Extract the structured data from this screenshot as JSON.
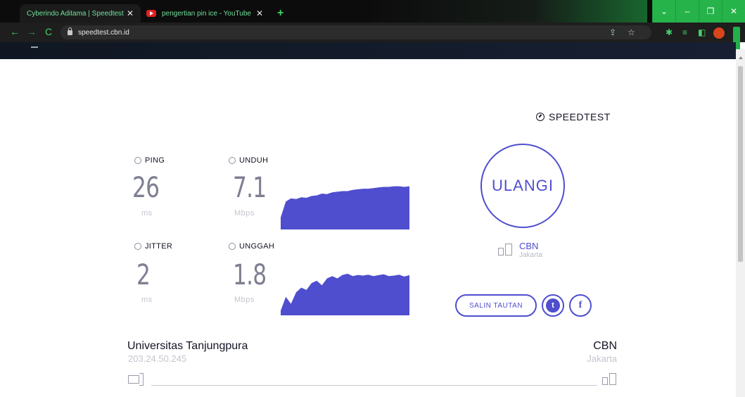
{
  "browser": {
    "tabs": [
      {
        "title": "Cyberindo Aditama | Speedtest",
        "active": true
      },
      {
        "title": "pengertian pin ice - YouTube",
        "active": false
      }
    ],
    "close_glyph": "✕",
    "new_tab_glyph": "+",
    "url": "speedtest.cbn.id",
    "nav": {
      "back": "←",
      "forward": "→",
      "reload": "C"
    },
    "window_controls": {
      "dropdown": "⌄",
      "minimize": "–",
      "restore": "❐",
      "close": "✕"
    },
    "toolbar_icons": {
      "share": "⇪",
      "star": "☆",
      "extensions": "✱",
      "reading_list": "≡",
      "side_panel": "◧"
    },
    "accent_color": "#23b04a"
  },
  "speedtest": {
    "brand": "SPEEDTEST",
    "ping": {
      "label": "PING",
      "value": "26",
      "unit": "ms"
    },
    "download": {
      "label": "UNDUH",
      "value": "7.1",
      "unit": "Mbps"
    },
    "jitter": {
      "label": "JITTER",
      "value": "2",
      "unit": "ms"
    },
    "upload": {
      "label": "UNGGAH",
      "value": "1.8",
      "unit": "Mbps"
    },
    "go_button": "ULANGI",
    "isp": {
      "name": "CBN",
      "city": "Jakarta"
    },
    "share": {
      "copy_link": "SALIN TAUTAN",
      "twitter": "t",
      "facebook": "f"
    },
    "client": {
      "name": "Universitas Tanjungpura",
      "ip": "203.24.50.245"
    },
    "server": {
      "name": "CBN",
      "city": "Jakarta"
    },
    "accent_color": "#4f4ecf"
  },
  "chart_data": [
    {
      "type": "area",
      "name": "download",
      "x": [
        0,
        1,
        2,
        3,
        4,
        5,
        6,
        7,
        8,
        9,
        10,
        11,
        12,
        13,
        14,
        15,
        16,
        17,
        18,
        19,
        20,
        21,
        22,
        23,
        24,
        25
      ],
      "values": [
        2.0,
        4.6,
        5.1,
        5.0,
        5.3,
        5.2,
        5.5,
        5.6,
        5.9,
        5.8,
        6.1,
        6.2,
        6.3,
        6.3,
        6.5,
        6.6,
        6.7,
        6.7,
        6.8,
        6.9,
        7.0,
        7.0,
        7.1,
        7.1,
        7.0,
        7.1
      ],
      "ylim": [
        0,
        7.4
      ]
    },
    {
      "type": "area",
      "name": "upload",
      "x": [
        0,
        1,
        2,
        3,
        4,
        5,
        6,
        7,
        8,
        9,
        10,
        11,
        12,
        13,
        14,
        15,
        16,
        17,
        18,
        19,
        20,
        21,
        22,
        23,
        24,
        25
      ],
      "values": [
        0.2,
        0.8,
        0.5,
        1.0,
        1.2,
        1.1,
        1.4,
        1.5,
        1.3,
        1.6,
        1.7,
        1.6,
        1.75,
        1.8,
        1.7,
        1.75,
        1.72,
        1.76,
        1.7,
        1.74,
        1.78,
        1.7,
        1.72,
        1.76,
        1.68,
        1.74
      ],
      "ylim": [
        0,
        1.95
      ]
    }
  ]
}
